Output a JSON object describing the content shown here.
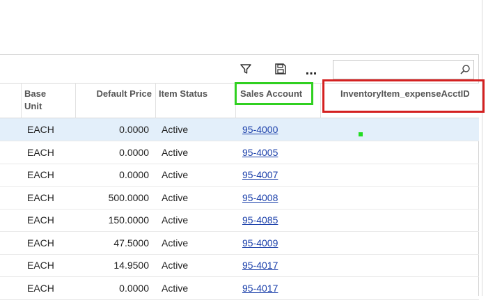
{
  "toolbar": {
    "filter_icon": "filter-icon",
    "save_icon": "floppy-disk-icon",
    "more_label": "...",
    "search": {
      "value": "",
      "placeholder": ""
    }
  },
  "columns": {
    "base_unit": [
      "Base",
      "Unit"
    ],
    "default_price": "Default Price",
    "item_status": "Item Status",
    "sales_account": "Sales Account",
    "expense_acct": "InventoryItem_expenseAcctID"
  },
  "rows": [
    {
      "base_unit": "EACH",
      "default_price": "0.0000",
      "item_status": "Active",
      "sales_account": "95-4000",
      "expense_acct": ""
    },
    {
      "base_unit": "EACH",
      "default_price": "0.0000",
      "item_status": "Active",
      "sales_account": "95-4005",
      "expense_acct": ""
    },
    {
      "base_unit": "EACH",
      "default_price": "0.0000",
      "item_status": "Active",
      "sales_account": "95-4007",
      "expense_acct": ""
    },
    {
      "base_unit": "EACH",
      "default_price": "500.0000",
      "item_status": "Active",
      "sales_account": "95-4008",
      "expense_acct": ""
    },
    {
      "base_unit": "EACH",
      "default_price": "150.0000",
      "item_status": "Active",
      "sales_account": "95-4085",
      "expense_acct": ""
    },
    {
      "base_unit": "EACH",
      "default_price": "47.5000",
      "item_status": "Active",
      "sales_account": "95-4009",
      "expense_acct": ""
    },
    {
      "base_unit": "EACH",
      "default_price": "14.9500",
      "item_status": "Active",
      "sales_account": "95-4017",
      "expense_acct": ""
    },
    {
      "base_unit": "EACH",
      "default_price": "0.0000",
      "item_status": "Active",
      "sales_account": "95-4017",
      "expense_acct": ""
    }
  ],
  "selected_row_index": 0,
  "colors": {
    "selected_row": "#e3effa",
    "link": "#1a3faa",
    "highlight_green": "#30d020",
    "highlight_red": "#d42020"
  }
}
